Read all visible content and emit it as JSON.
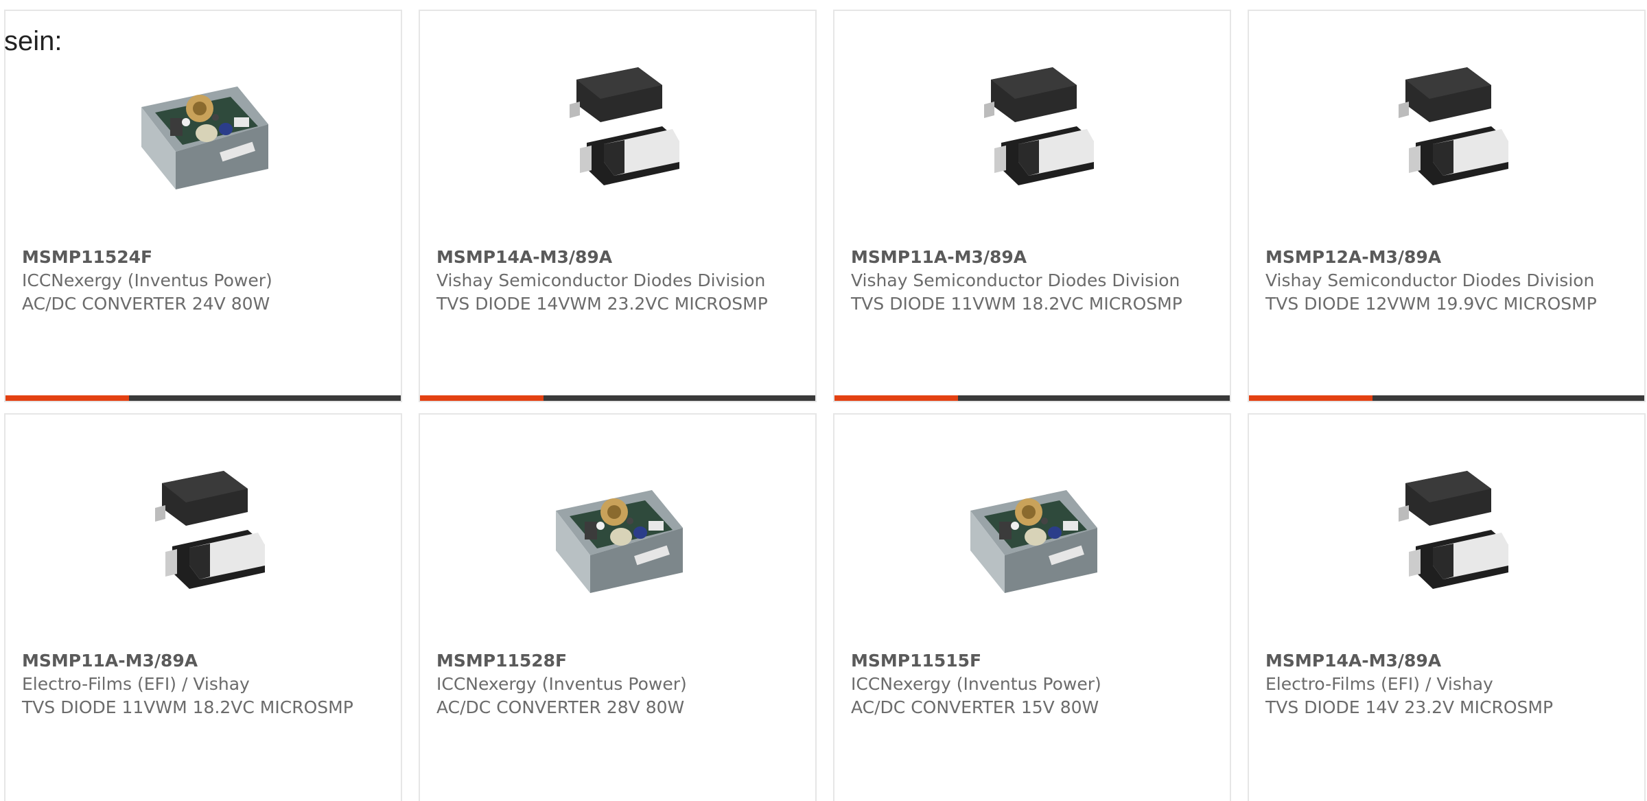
{
  "intro": {
    "text": "sein:"
  },
  "colors": {
    "accent": "#e34112",
    "bar_dark": "#3a3a3a",
    "card_border": "#e6e6e6",
    "text": "#6b6b6b"
  },
  "products": [
    {
      "part_number": "MSMP11524F",
      "manufacturer": "ICCNexergy (Inventus Power)",
      "description": "AC/DC CONVERTER 24V 80W",
      "image": "power-supply-icon"
    },
    {
      "part_number": "MSMP14A-M3/89A",
      "manufacturer": "Vishay Semiconductor Diodes Division",
      "description": "TVS DIODE 14VWM 23.2VC MICROSMP",
      "image": "diode-package-icon"
    },
    {
      "part_number": "MSMP11A-M3/89A",
      "manufacturer": "Vishay Semiconductor Diodes Division",
      "description": "TVS DIODE 11VWM 18.2VC MICROSMP",
      "image": "diode-package-icon"
    },
    {
      "part_number": "MSMP12A-M3/89A",
      "manufacturer": "Vishay Semiconductor Diodes Division",
      "description": "TVS DIODE 12VWM 19.9VC MICROSMP",
      "image": "diode-package-icon"
    },
    {
      "part_number": "MSMP11A-M3/89A",
      "manufacturer": "Electro-Films (EFI) / Vishay",
      "description": "TVS DIODE 11VWM 18.2VC MICROSMP",
      "image": "diode-package-icon"
    },
    {
      "part_number": "MSMP11528F",
      "manufacturer": "ICCNexergy (Inventus Power)",
      "description": "AC/DC CONVERTER 28V 80W",
      "image": "power-supply-icon"
    },
    {
      "part_number": "MSMP11515F",
      "manufacturer": "ICCNexergy (Inventus Power)",
      "description": "AC/DC CONVERTER 15V 80W",
      "image": "power-supply-icon"
    },
    {
      "part_number": "MSMP14A-M3/89A",
      "manufacturer": "Electro-Films (EFI) / Vishay",
      "description": "TVS DIODE 14V 23.2V MICROSMP",
      "image": "diode-package-icon"
    }
  ]
}
